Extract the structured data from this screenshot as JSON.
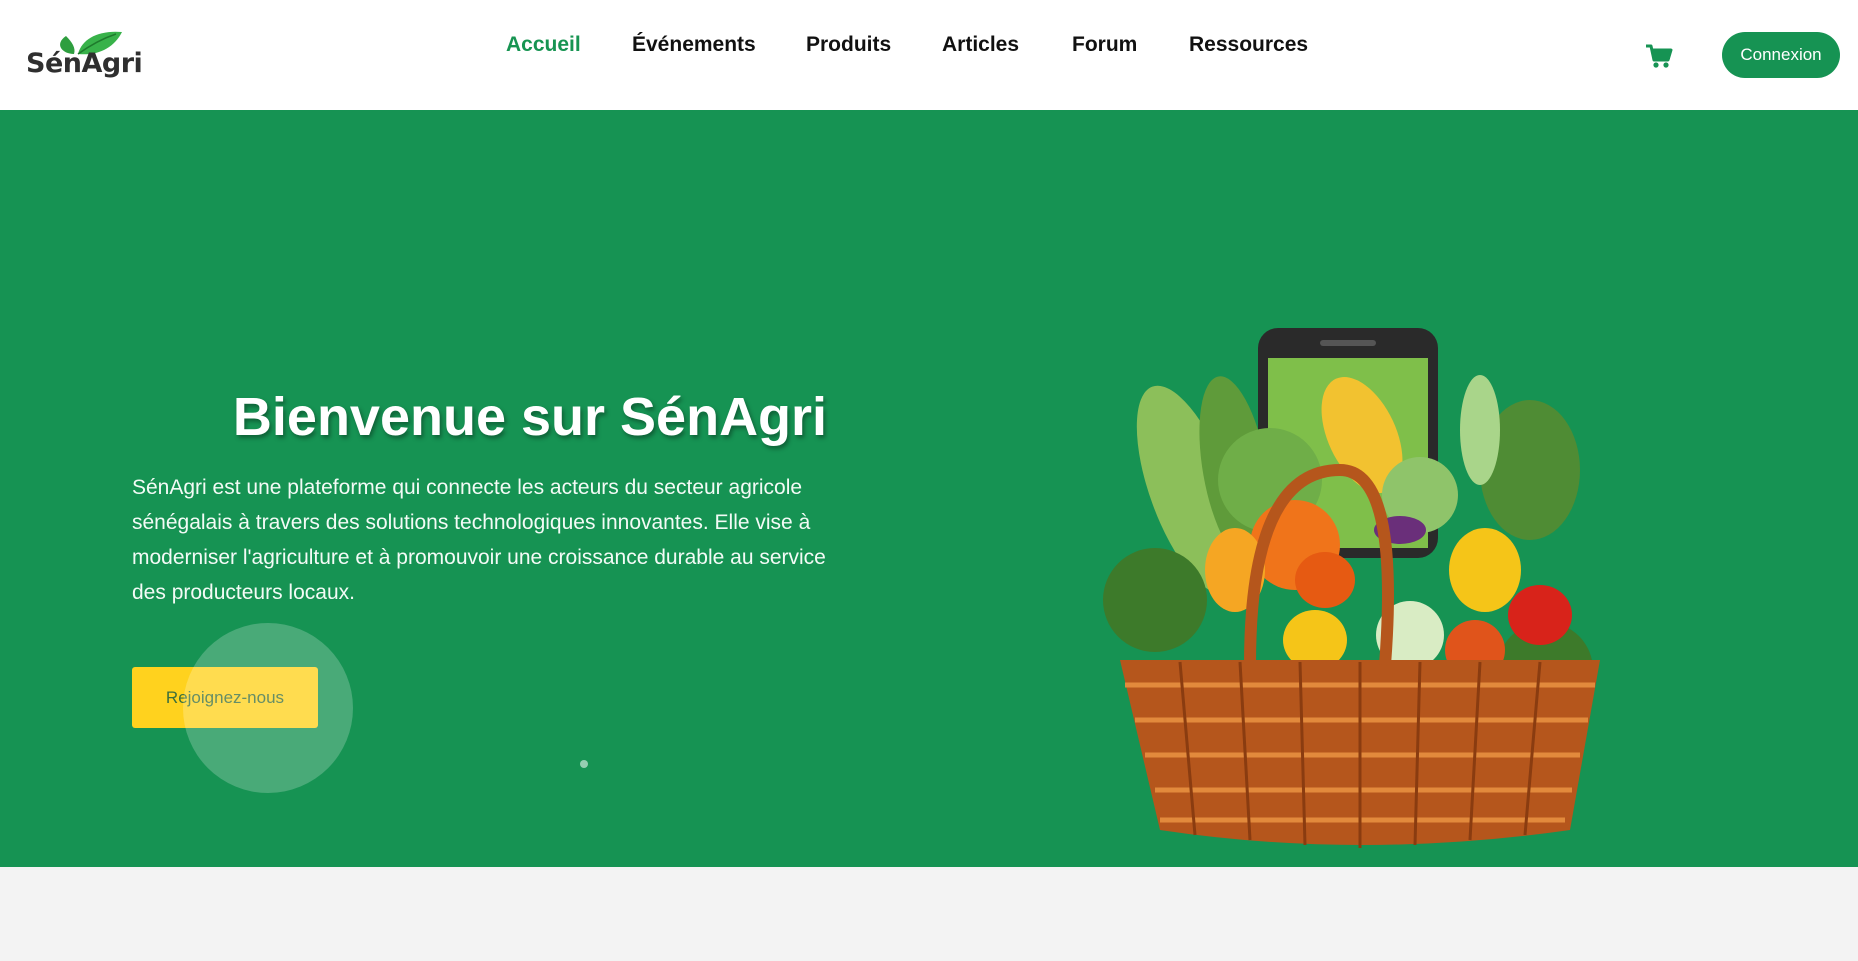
{
  "brand": {
    "logo_text": "SénAgri"
  },
  "nav": {
    "items": [
      {
        "label": "Accueil",
        "active": true
      },
      {
        "label": "Événements",
        "active": false
      },
      {
        "label": "Produits",
        "active": false
      },
      {
        "label": "Articles",
        "active": false
      },
      {
        "label": "Forum",
        "active": false
      },
      {
        "label": "Ressources",
        "active": false
      }
    ]
  },
  "header": {
    "cart_icon": "shopping-cart-icon",
    "login_label": "Connexion"
  },
  "hero": {
    "title": "Bienvenue sur SénAgri",
    "description": "SénAgri est une plateforme qui connecte les acteurs du secteur agricole sénégalais à travers des solutions technologiques innovantes. Elle vise à moderniser l'agriculture et à promouvoir une croissance durable au service des producteurs locaux.",
    "cta_label": "Rejoignez-nous",
    "image": "vegetable-basket-phone-illustration"
  },
  "colors": {
    "brand_green": "#169353",
    "accent_yellow": "#ffd21e",
    "page_bg": "#f3f3f3"
  }
}
